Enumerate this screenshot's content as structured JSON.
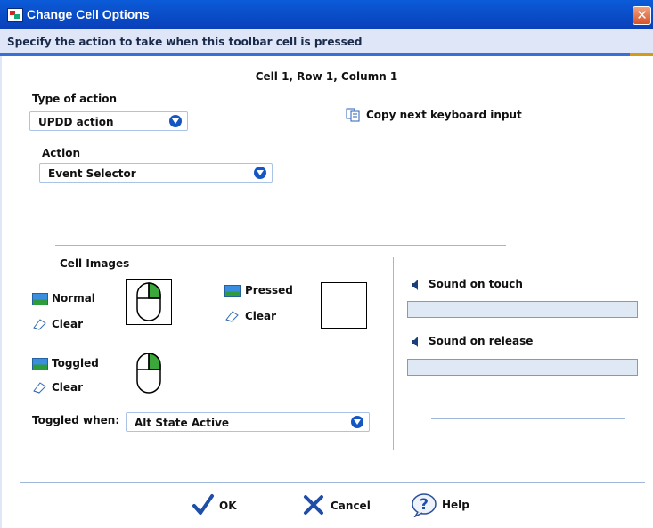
{
  "window": {
    "title": "Change Cell Options",
    "subtitle": "Specify the action to take when this toolbar cell is pressed",
    "close_glyph": "✕"
  },
  "cell": {
    "heading": "Cell 1, Row 1, Column 1"
  },
  "type_of_action": {
    "label": "Type of action",
    "value": "UPDD action"
  },
  "copy_keyboard": {
    "label": "Copy next keyboard input"
  },
  "action": {
    "label": "Action",
    "value": "Event Selector"
  },
  "cell_images": {
    "heading": "Cell Images",
    "normal_label": "Normal",
    "pressed_label": "Pressed",
    "toggled_label": "Toggled",
    "clear_label": "Clear"
  },
  "toggled_when": {
    "label": "Toggled when:",
    "value": "Alt State Active"
  },
  "sound": {
    "touch_label": "Sound on touch",
    "touch_value": "",
    "release_label": "Sound on release",
    "release_value": ""
  },
  "buttons": {
    "ok": "OK",
    "cancel": "Cancel",
    "help": "Help"
  },
  "colors": {
    "title_bar": "#0a47c8",
    "accent": "#1557c2",
    "sound_field": "#dfe9f5",
    "close": "#d7532c"
  }
}
